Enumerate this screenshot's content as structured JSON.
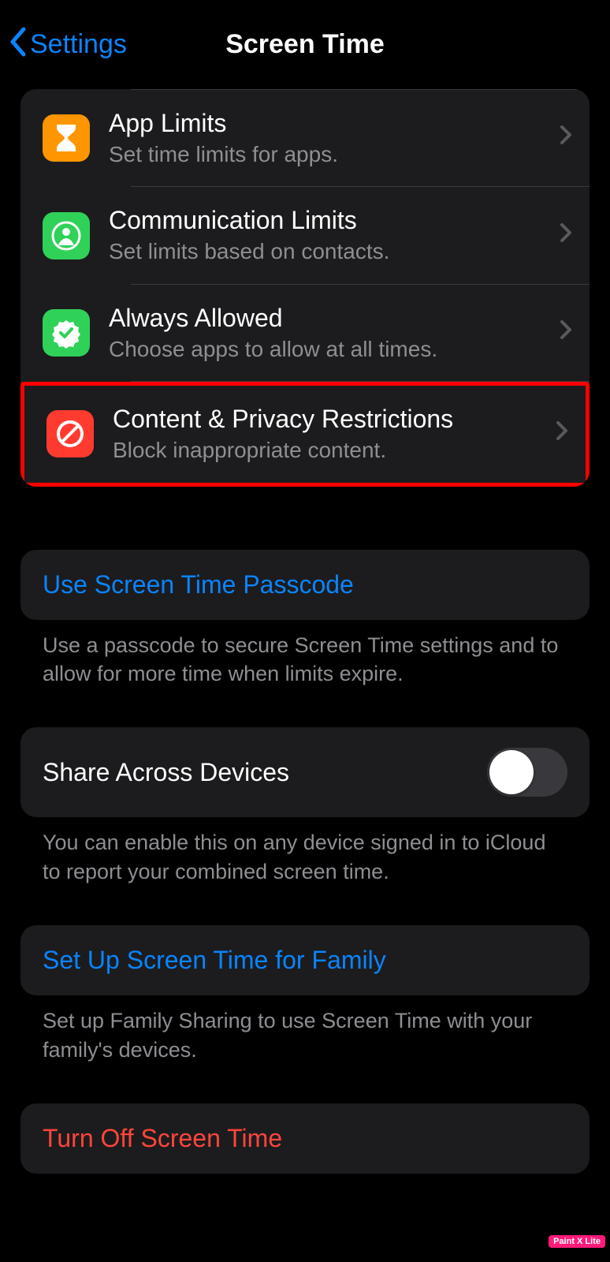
{
  "nav": {
    "back_label": "Settings",
    "title": "Screen Time"
  },
  "rows": {
    "app_limits": {
      "title": "App Limits",
      "subtitle": "Set time limits for apps."
    },
    "comm_limits": {
      "title": "Communication Limits",
      "subtitle": "Set limits based on contacts."
    },
    "always_allowed": {
      "title": "Always Allowed",
      "subtitle": "Choose apps to allow at all times."
    },
    "content_privacy": {
      "title": "Content & Privacy Restrictions",
      "subtitle": "Block inappropriate content."
    }
  },
  "passcode": {
    "label": "Use Screen Time Passcode",
    "footer": "Use a passcode to secure Screen Time settings and to allow for more time when limits expire."
  },
  "share": {
    "label": "Share Across Devices",
    "footer": "You can enable this on any device signed in to iCloud to report your combined screen time."
  },
  "family": {
    "label": "Set Up Screen Time for Family",
    "footer": "Set up Family Sharing to use Screen Time with your family's devices."
  },
  "turn_off": {
    "label": "Turn Off Screen Time"
  },
  "watermark": "Paint X Lite"
}
